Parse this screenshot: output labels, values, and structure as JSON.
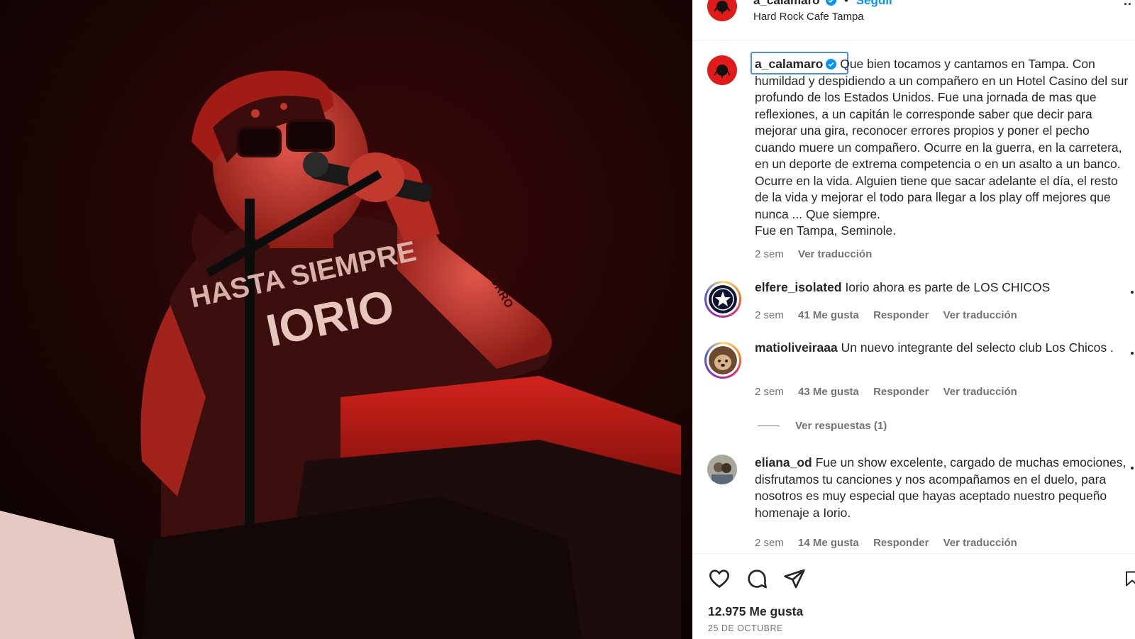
{
  "header": {
    "username": "a_calamaro",
    "separator": "•",
    "follow_label": "Seguir",
    "location": "Hard Rock Cafe Tampa",
    "more_label": "··"
  },
  "caption": {
    "username": "a_calamaro",
    "text": "Que bien tocamos y cantamos en Tampa. Con humildad y despidiendo a un compañero en un Hotel Casino del sur profundo de los Estados Unidos. Fue una jornada de mas que reflexiones, a un capitán le corresponde saber que decir para mejorar una gira, reconocer errores propios y poner el pecho cuando muere un compañero. Ocurre en la guerra, en la carretera, en un deporte de extrema competencia o en un asalto a un banco. Ocurre en la vida. Alguien tiene que sacar adelante el día, el resto de la vida y mejorar el todo para llegar a los play off mejores que nunca ... Que siempre.",
    "text_line2": "Fue en Tampa, Seminole.",
    "time": "2 sem",
    "translate": "Ver traducción"
  },
  "comments": [
    {
      "username": "elfere_isolated",
      "text": "Iorio ahora es parte de LOS CHICOS",
      "time": "2 sem",
      "likes": "41 Me gusta",
      "reply": "Responder",
      "translate": "Ver traducción"
    },
    {
      "username": "matioliveiraaa",
      "text": "Un nuevo integrante del selecto club Los Chicos .",
      "time": "2 sem",
      "likes": "43 Me gusta",
      "reply": "Responder",
      "translate": "Ver traducción",
      "view_replies": "Ver respuestas (1)"
    },
    {
      "username": "eliana_od",
      "text": "Fue un show excelente, cargado de muchas emociones, disfrutamos tu canciones y nos acompañamos en el duelo, para nosotros es muy especial que hayas aceptado nuestro pequeño homenaje a Iorio.",
      "time": "2 sem",
      "likes": "14 Me gusta",
      "reply": "Responder",
      "translate": "Ver traducción"
    }
  ],
  "footer": {
    "likes": "12.975 Me gusta",
    "date": "25 DE OCTUBRE"
  },
  "photo": {
    "shirt_text_top": "HASTA SIEMPRE",
    "shirt_text_bottom": "IORIO",
    "arm_tattoo": "CURRO"
  },
  "colors": {
    "link_blue": "#0095f6",
    "verified_blue": "#0095f6",
    "text": "#262626",
    "muted": "#737373",
    "stage_red": "#b3140f"
  },
  "icons": {
    "like": "heart-icon",
    "comment": "comment-bubble-icon",
    "share": "paper-plane-icon",
    "save": "bookmark-icon",
    "more": "more-options-icon"
  }
}
